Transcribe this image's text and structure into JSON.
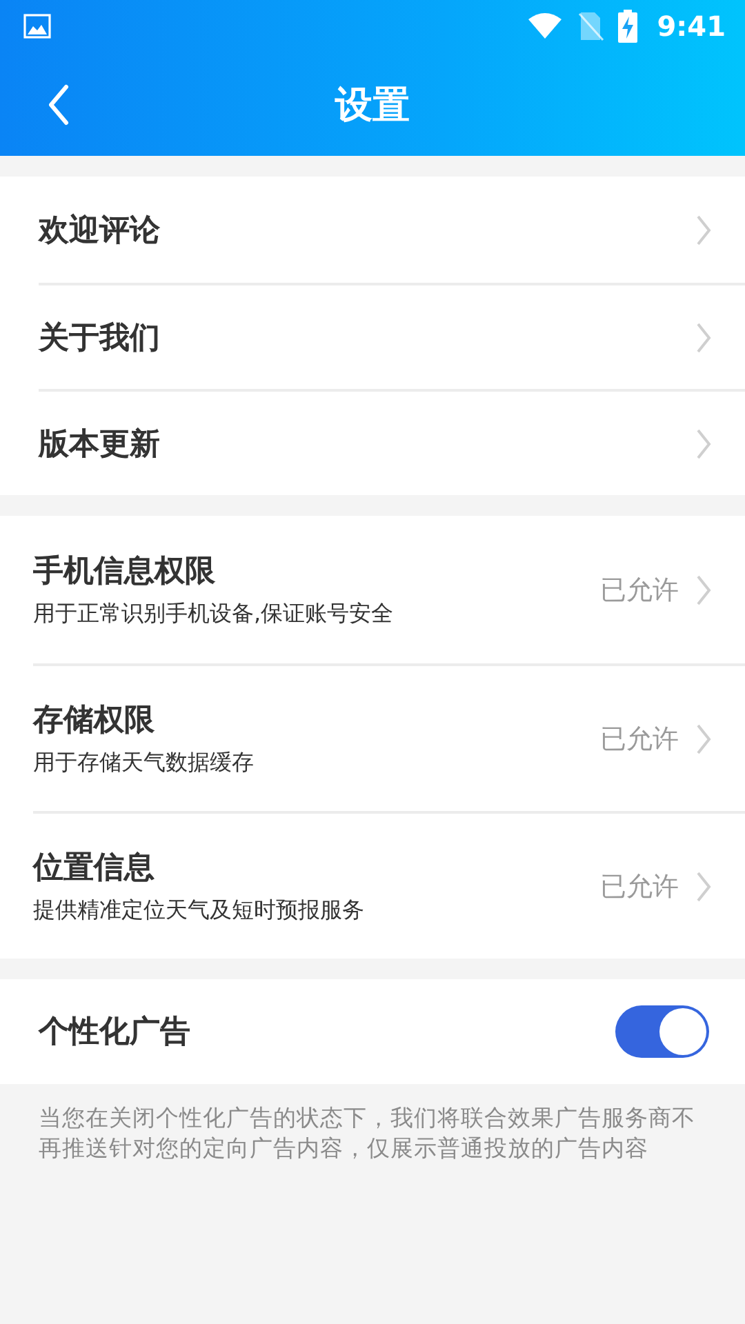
{
  "status_bar": {
    "time": "9:41"
  },
  "header": {
    "title": "设置"
  },
  "groups": [
    {
      "items": [
        {
          "title": "欢迎评论"
        },
        {
          "title": "关于我们"
        },
        {
          "title": "版本更新"
        }
      ]
    },
    {
      "items": [
        {
          "title": "手机信息权限",
          "subtitle": "用于正常识别手机设备,保证账号安全",
          "status": "已允许"
        },
        {
          "title": "存储权限",
          "subtitle": "用于存储天气数据缓存",
          "status": "已允许"
        },
        {
          "title": "位置信息",
          "subtitle": "提供精准定位天气及短时预报服务",
          "status": "已允许"
        }
      ]
    }
  ],
  "ad_setting": {
    "label": "个性化广告",
    "on": true
  },
  "note": "当您在关闭个性化广告的状态下，我们将联合效果广告服务商不再推送针对您的定向广告内容，仅展示普通投放的广告内容"
}
